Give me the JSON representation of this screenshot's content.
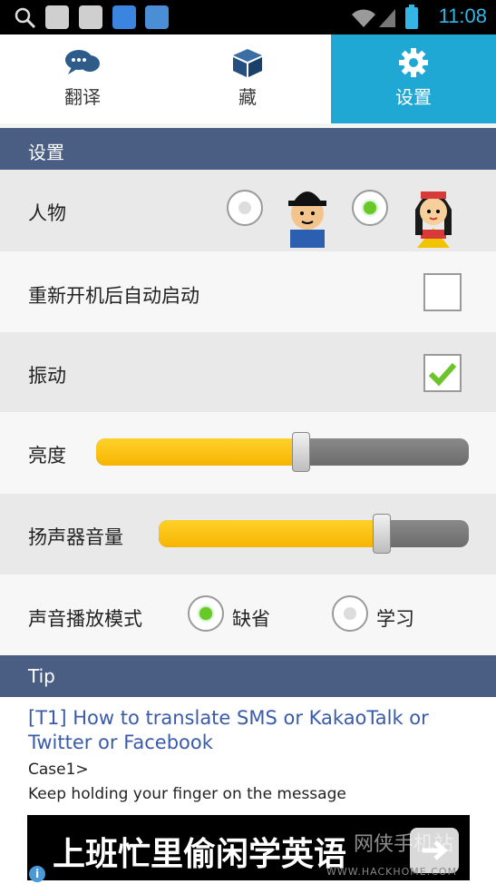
{
  "status_bar": {
    "time": "11:08",
    "icons": [
      "search-icon",
      "app-icon",
      "app-icon",
      "baidu-icon",
      "app-icon",
      "wifi-icon",
      "signal-icon",
      "battery-icon"
    ]
  },
  "tabs": [
    {
      "label": "翻译",
      "icon": "chat-bubbles-icon"
    },
    {
      "label": "藏",
      "icon": "box-icon"
    },
    {
      "label": "设置",
      "icon": "gear-icon",
      "active": true
    }
  ],
  "settings": {
    "header": "设置",
    "character": {
      "label": "人物",
      "selected": 2
    },
    "autostart": {
      "label": "重新开机后自动启动",
      "checked": false
    },
    "vibrate": {
      "label": "振动",
      "checked": true
    },
    "brightness": {
      "label": "亮度",
      "value_percent": 55
    },
    "speaker_volume": {
      "label": "扬声器音量",
      "value_percent": 72
    },
    "playback_mode": {
      "label": "声音播放模式",
      "options": [
        "缺省",
        "学习"
      ],
      "selected": 0
    }
  },
  "tip": {
    "header": "Tip",
    "title": "[T1] How to translate SMS or KakaoTalk or Twitter or Facebook",
    "lines": [
      "Case1>",
      "Keep holding your finger on the message"
    ]
  },
  "ad": {
    "text": "上班忙里偷闲学英语",
    "watermark": "网侠手机站",
    "watermark_url": "WWW.HACKHOME.COM"
  },
  "colors": {
    "active_tab": "#1fa8d3",
    "section_header": "#4a5d82",
    "slider_fill": "#f6b400"
  }
}
